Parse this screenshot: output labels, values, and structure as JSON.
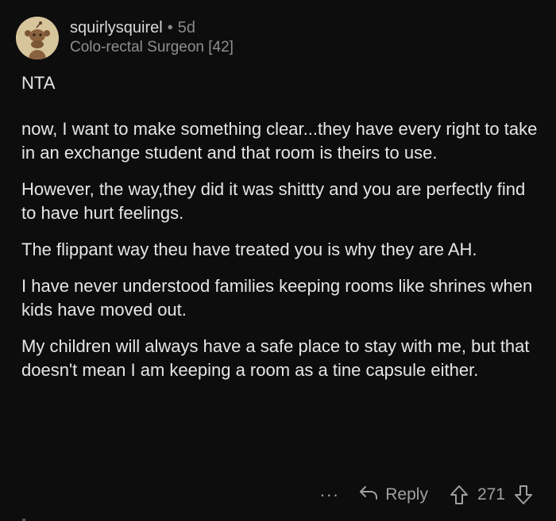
{
  "comment": {
    "username": "squirlysquirel",
    "separator": "•",
    "age": "5d",
    "flair": "Colo-rectal Surgeon [42]",
    "paragraphs": [
      "NTA",
      "now, I want to make something clear...they have every right to take in an exchange student and that room is theirs to use.",
      "However, the way,they did it was shittty and you are perfectly find to have hurt feelings.",
      "The flippant way theu have treated you is why they are AH.",
      "I have never understood families keeping rooms like shrines when kids have moved out.",
      "My children will always have a safe place to stay with me, but that doesn't mean I am  keeping a room as a tine capsule either."
    ],
    "avatar_icon": "snoo-avatar-icon",
    "avatar_bg": "#d7c59b"
  },
  "actions": {
    "more_label": "···",
    "reply_label": "Reply",
    "score": "271",
    "reply_icon": "reply-arrow-icon",
    "upvote_icon": "upvote-arrow-icon",
    "downvote_icon": "downvote-arrow-icon"
  },
  "colors": {
    "background": "#0d0d0d",
    "text": "#e6e6e6",
    "muted": "#8a8a8a",
    "action": "#a0a0a0"
  }
}
